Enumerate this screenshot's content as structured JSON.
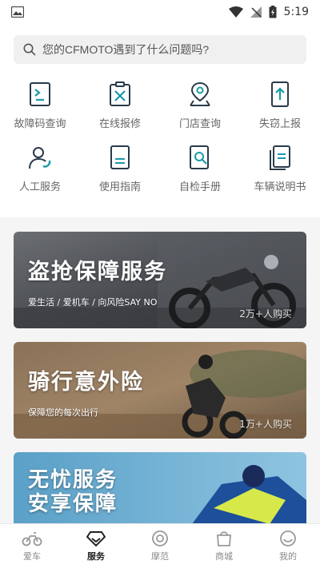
{
  "status": {
    "time": "5:19"
  },
  "search": {
    "placeholder": "您的CFMOTO遇到了什么问题吗?"
  },
  "services": [
    {
      "label": "故障码查询",
      "icon": "fault-code-icon"
    },
    {
      "label": "在线报修",
      "icon": "repair-tools-icon"
    },
    {
      "label": "门店查询",
      "icon": "store-location-icon"
    },
    {
      "label": "失窃上报",
      "icon": "theft-report-icon"
    },
    {
      "label": "人工服务",
      "icon": "customer-service-icon"
    },
    {
      "label": "使用指南",
      "icon": "user-guide-icon"
    },
    {
      "label": "自检手册",
      "icon": "self-check-manual-icon"
    },
    {
      "label": "车辆说明书",
      "icon": "vehicle-manual-icon"
    }
  ],
  "banners": [
    {
      "title": "盗抢保障服务",
      "subtitle": "爱生活 / 爱机车 / 向风险SAY NO",
      "count": "2万+人购买"
    },
    {
      "title": "骑行意外险",
      "subtitle": "保障您的每次出行",
      "count": "1万+人购买"
    },
    {
      "title_line1": "无忧服务",
      "title_line2": "安享保障"
    }
  ],
  "tabs": [
    {
      "label": "爱车",
      "icon": "motorcycle-icon"
    },
    {
      "label": "服务",
      "icon": "diamond-icon"
    },
    {
      "label": "摩范",
      "icon": "circle-target-icon"
    },
    {
      "label": "商城",
      "icon": "shopping-bag-icon"
    },
    {
      "label": "我的",
      "icon": "smile-icon"
    }
  ],
  "colors": {
    "accent": "#1a9aa6",
    "icon_dark": "#2a3a4a"
  }
}
